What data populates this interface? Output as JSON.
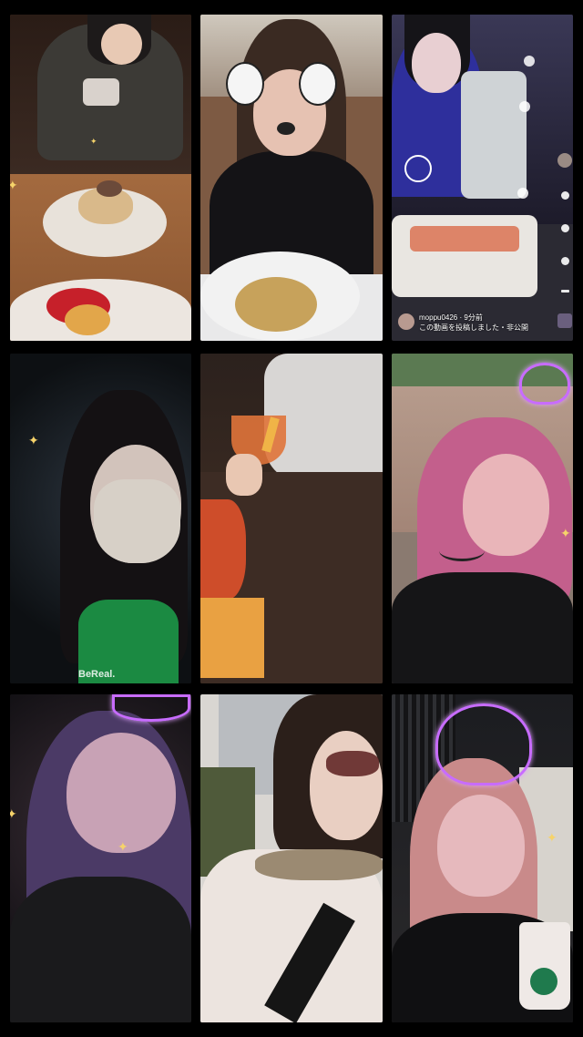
{
  "tiles": [
    {
      "id": "r1c1",
      "scene": "pancake-dessert"
    },
    {
      "id": "r1c2",
      "scene": "dog-filter-pasta"
    },
    {
      "id": "r1c3",
      "scene": "video-post-screen"
    },
    {
      "id": "r2c1",
      "scene": "masked-selfie"
    },
    {
      "id": "r2c2",
      "scene": "cocktail"
    },
    {
      "id": "r2c3",
      "scene": "pink-hair-selfie"
    },
    {
      "id": "r3c1",
      "scene": "purple-hair-selfie"
    },
    {
      "id": "r3c2",
      "scene": "sunglasses-selfie"
    },
    {
      "id": "r3c3",
      "scene": "kuromi-filter-drink"
    }
  ],
  "video_post": {
    "username": "moppu0426 · 9分前",
    "caption": "この動画を投稿しました・非公開"
  },
  "bereal_label": "BeReal."
}
